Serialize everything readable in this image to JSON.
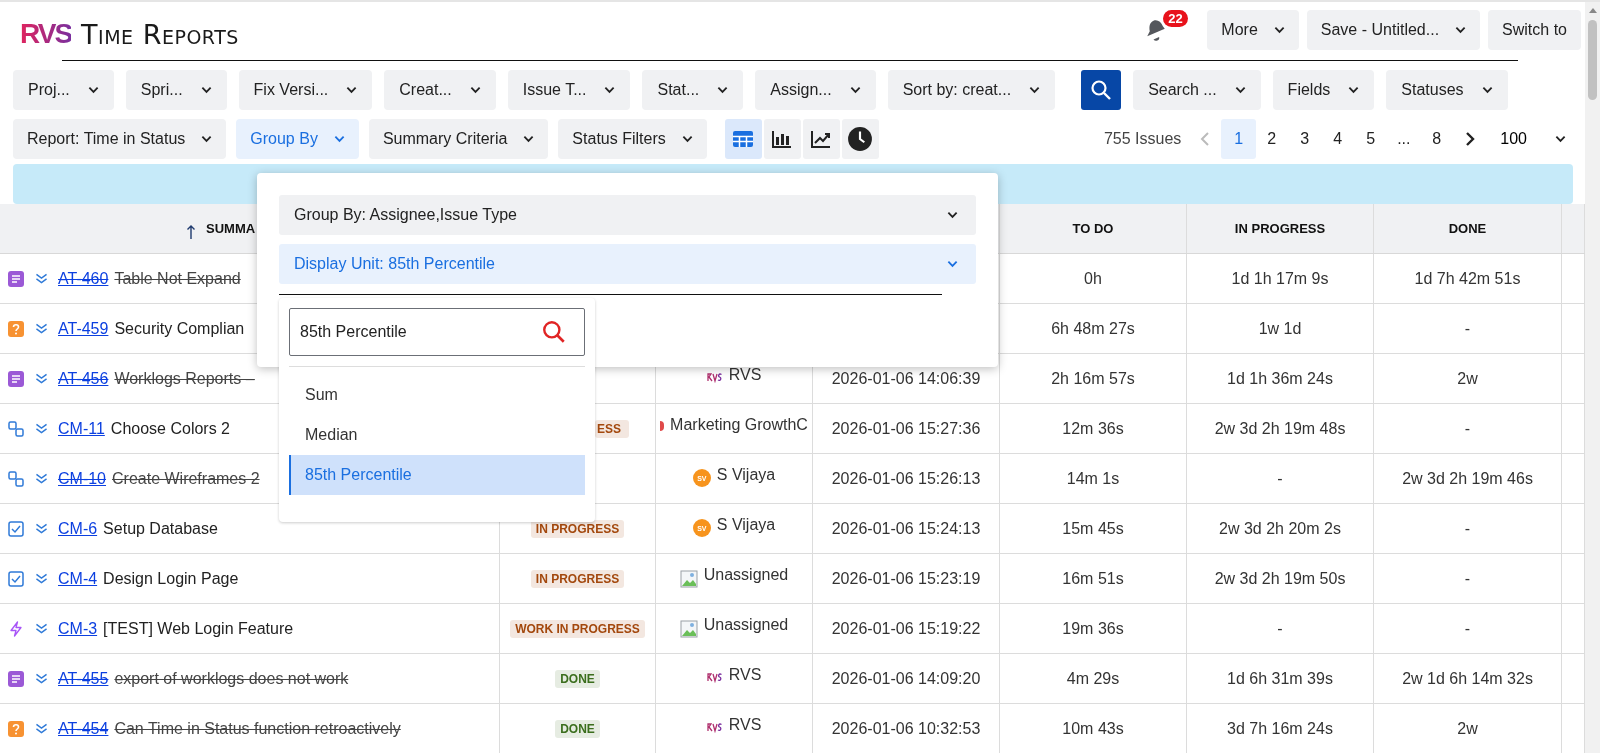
{
  "header": {
    "logo": "RVS",
    "title": "Time Reports",
    "notifications": "22",
    "buttons": [
      {
        "label": "More",
        "dropdown": true
      },
      {
        "label": "Save - Untitled...",
        "dropdown": true
      },
      {
        "label": "Switch to",
        "dropdown": false
      }
    ]
  },
  "filters": [
    {
      "label": "Proj..."
    },
    {
      "label": "Spri..."
    },
    {
      "label": "Fix Versi..."
    },
    {
      "label": "Creat..."
    },
    {
      "label": "Issue T..."
    },
    {
      "label": "Stat..."
    },
    {
      "label": "Assign..."
    },
    {
      "label": "Sort by: creat..."
    }
  ],
  "search_tools": [
    {
      "label": "Search ..."
    },
    {
      "label": "Fields"
    },
    {
      "label": "Statuses"
    }
  ],
  "report_menus": [
    {
      "label": "Report: Time in Status",
      "selected": false
    },
    {
      "label": "Group By",
      "selected": true
    },
    {
      "label": "Summary Criteria",
      "selected": false
    },
    {
      "label": "Status Filters",
      "selected": false
    }
  ],
  "views": [
    {
      "kind": "table",
      "selected": true
    },
    {
      "kind": "bar",
      "selected": false
    },
    {
      "kind": "line",
      "selected": false
    },
    {
      "kind": "clock",
      "selected": false
    }
  ],
  "pager": {
    "count": "755 Issues",
    "prev": {
      "disabled": true
    },
    "pages": [
      {
        "label": "1",
        "selected": true
      },
      {
        "label": "2",
        "selected": false
      },
      {
        "label": "3",
        "selected": false
      },
      {
        "label": "4",
        "selected": false
      },
      {
        "label": "5",
        "selected": false
      },
      {
        "label": "...",
        "selected": false
      },
      {
        "label": "8",
        "selected": false
      }
    ],
    "next": {
      "disabled": false
    },
    "page_size": "100"
  },
  "group_by_panel": {
    "selects": [
      {
        "label": "Group By: Assignee,Issue Type",
        "selected": false
      },
      {
        "label": "Display Unit: 85th Percentile",
        "selected": true
      }
    ],
    "search": {
      "value": "85th Percentile"
    },
    "options": [
      {
        "label": "Sum",
        "selected": false
      },
      {
        "label": "Median",
        "selected": false
      },
      {
        "label": "85th Percentile",
        "selected": true
      }
    ]
  },
  "table": {
    "columns": [
      {
        "label": "SUMMA",
        "sorted_ascending": true
      },
      {
        "label": "TO DO"
      },
      {
        "label": "IN PROGRESS"
      },
      {
        "label": "DONE"
      }
    ],
    "rows": [
      {
        "kind": "story",
        "priority": {
          "kind": "lowest"
        },
        "key": "AT-460",
        "summary": "Table Not Expand",
        "resolved": true,
        "todo": "0h",
        "in_progress": "1d 1h 17m 9s",
        "done": "1d 7h 42m 51s"
      },
      {
        "kind": "question",
        "priority": {
          "kind": "lowest"
        },
        "key": "AT-459",
        "summary": "Security Complian",
        "resolved": false,
        "todo": "6h 48m 27s",
        "in_progress": "1w 1d",
        "done": "-"
      },
      {
        "kind": "story",
        "priority": {
          "kind": "lowest"
        },
        "key": "AT-456",
        "summary": "Worklogs Reports –",
        "resolved": true,
        "assignee": {
          "name": "RVS",
          "kind": "logo"
        },
        "created": "2026-01-06 14:06:39",
        "todo": "2h 16m 57s",
        "in_progress": "1d 1h 36m 24s",
        "done": "2w"
      },
      {
        "kind": "subtask",
        "priority": {
          "kind": "lowest"
        },
        "key": "CM-11",
        "summary": "Choose Colors 2",
        "resolved": false,
        "status": {
          "text": "ESS",
          "color": "#a3480d",
          "cut": true
        },
        "assignee": {
          "name": "Marketing GrowthC",
          "kind": "dot"
        },
        "created": "2026-01-06 15:27:36",
        "todo": "12m 36s",
        "in_progress": "2w 3d 2h 19m 48s",
        "done": "-"
      },
      {
        "kind": "subtask",
        "priority": {
          "kind": "lowest"
        },
        "key": "CM-10",
        "summary": "Create Wireframes 2",
        "resolved": true,
        "assignee": {
          "name": "S Vijaya",
          "kind": "initials",
          "initials": "SV"
        },
        "created": "2026-01-06 15:26:13",
        "todo": "14m 1s",
        "in_progress": "-",
        "done": "2w 3d 2h 19m 46s"
      },
      {
        "kind": "task",
        "priority": {
          "kind": "lowest"
        },
        "key": "CM-6",
        "summary": "Setup Database",
        "resolved": false,
        "status": {
          "text": "IN PROGRESS",
          "color": "#a3480d",
          "cut": false
        },
        "assignee": {
          "name": "S Vijaya",
          "kind": "initials",
          "initials": "SV"
        },
        "created": "2026-01-06 15:24:13",
        "todo": "15m 45s",
        "in_progress": "2w 3d 2h 20m 2s",
        "done": "-"
      },
      {
        "kind": "task",
        "priority": {
          "kind": "lowest"
        },
        "key": "CM-4",
        "summary": "Design Login Page",
        "resolved": false,
        "status": {
          "text": "IN PROGRESS",
          "color": "#a3480d",
          "cut": false
        },
        "assignee": {
          "name": "Unassigned",
          "kind": "placeholder"
        },
        "created": "2026-01-06 15:23:19",
        "todo": "16m 51s",
        "in_progress": "2w 3d 2h 19m 50s",
        "done": "-"
      },
      {
        "kind": "epic",
        "priority": {
          "kind": "lowest"
        },
        "key": "CM-3",
        "summary": "[TEST] Web Login Feature",
        "resolved": false,
        "status": {
          "text": "WORK IN PROGRESS",
          "color": "#a3480d",
          "cut": false
        },
        "assignee": {
          "name": "Unassigned",
          "kind": "placeholder"
        },
        "created": "2026-01-06 15:19:22",
        "todo": "19m 36s",
        "in_progress": "-",
        "done": "-"
      },
      {
        "kind": "story",
        "priority": {
          "kind": "lowest"
        },
        "key": "AT-455",
        "summary": "export of worklogs does not work",
        "resolved": true,
        "status": {
          "text": "DONE",
          "color": "#3b6e1d",
          "cut": false
        },
        "assignee": {
          "name": "RVS",
          "kind": "logo"
        },
        "created": "2026-01-06 14:09:20",
        "todo": "4m 29s",
        "in_progress": "1d 6h 31m 39s",
        "done": "2w 1d 6h 14m 32s"
      },
      {
        "kind": "question",
        "priority": {
          "kind": "lowest"
        },
        "key": "AT-454",
        "summary": "Can Time in Status function retroactively",
        "resolved": true,
        "status": {
          "text": "DONE",
          "color": "#3b6e1d",
          "cut": false
        },
        "assignee": {
          "name": "RVS",
          "kind": "logo"
        },
        "created": "2026-01-06 10:32:53",
        "todo": "10m 43s",
        "in_progress": "3d 7h 16m 24s",
        "done": "2w"
      }
    ]
  }
}
